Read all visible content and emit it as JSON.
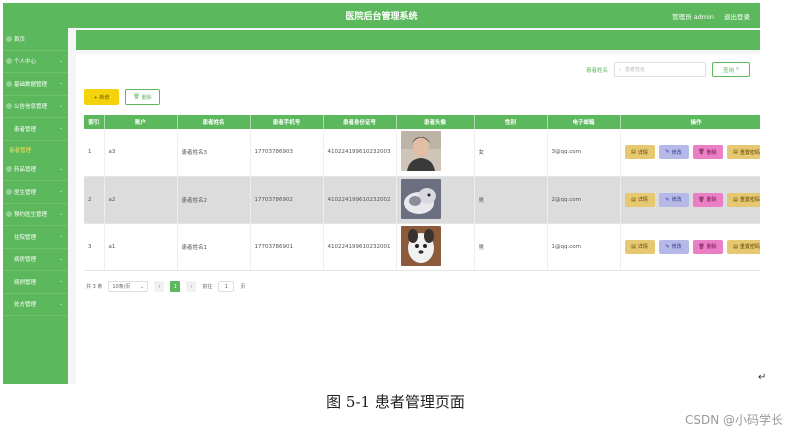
{
  "header": {
    "title": "医院后台管理系统",
    "user_label": "管理员 admin",
    "logout": "退出登录"
  },
  "sidebar": {
    "items": [
      {
        "label": "首页",
        "chevron": ""
      },
      {
        "label": "个人中心",
        "chevron": "⌄"
      },
      {
        "label": "基础数据管理",
        "chevron": "⌄"
      },
      {
        "label": "公告信息管理",
        "chevron": "⌄"
      },
      {
        "label": "患者管理",
        "chevron": "⌄"
      },
      {
        "label": "患者管理",
        "chevron": "",
        "sub": true
      },
      {
        "label": "药品管理",
        "chevron": "⌄"
      },
      {
        "label": "医生管理",
        "chevron": "⌄"
      },
      {
        "label": "预约医生管理",
        "chevron": "⌄"
      },
      {
        "label": "住院管理",
        "chevron": "⌄"
      },
      {
        "label": "病房管理",
        "chevron": "⌄"
      },
      {
        "label": "病例管理",
        "chevron": "⌄"
      },
      {
        "label": "处方管理",
        "chevron": "⌄"
      }
    ]
  },
  "search": {
    "label": "患者姓名",
    "placeholder": "患者姓名",
    "button": "查询"
  },
  "toolbar": {
    "add": "+ 新增",
    "delete": "删除"
  },
  "table": {
    "columns": [
      "索引",
      "账户",
      "患者姓名",
      "患者手机号",
      "患者身份证号",
      "患者头像",
      "性别",
      "电子邮箱",
      "操作"
    ],
    "rows": [
      {
        "index": "1",
        "account": "a3",
        "name": "患者姓名3",
        "phone": "17703786903",
        "idcard": "410224199610232003",
        "gender": "女",
        "email": "3@qq.com"
      },
      {
        "index": "2",
        "account": "a2",
        "name": "患者姓名2",
        "phone": "17703786902",
        "idcard": "410224199610232002",
        "gender": "男",
        "email": "2@qq.com"
      },
      {
        "index": "3",
        "account": "a1",
        "name": "患者姓名1",
        "phone": "17703786901",
        "idcard": "410224199610232001",
        "gender": "男",
        "email": "1@qq.com"
      }
    ],
    "ops": {
      "detail": "详情",
      "edit": "修改",
      "remove": "删除",
      "reset": "重置密码"
    }
  },
  "pager": {
    "total": "共 3 条",
    "page_size": "10条/页",
    "prev": "‹",
    "current": "1",
    "next": "›",
    "goto_label": "前往",
    "goto_value": "1",
    "page_suffix": "页"
  },
  "caption": "图 5-1 患者管理页面",
  "watermark": "CSDN @小码学长",
  "colors": {
    "primary": "#5cb85c",
    "add_button": "#f5d30a",
    "detail": "#e6c870",
    "edit": "#b6b9e8",
    "remove": "#ea7fc6"
  }
}
